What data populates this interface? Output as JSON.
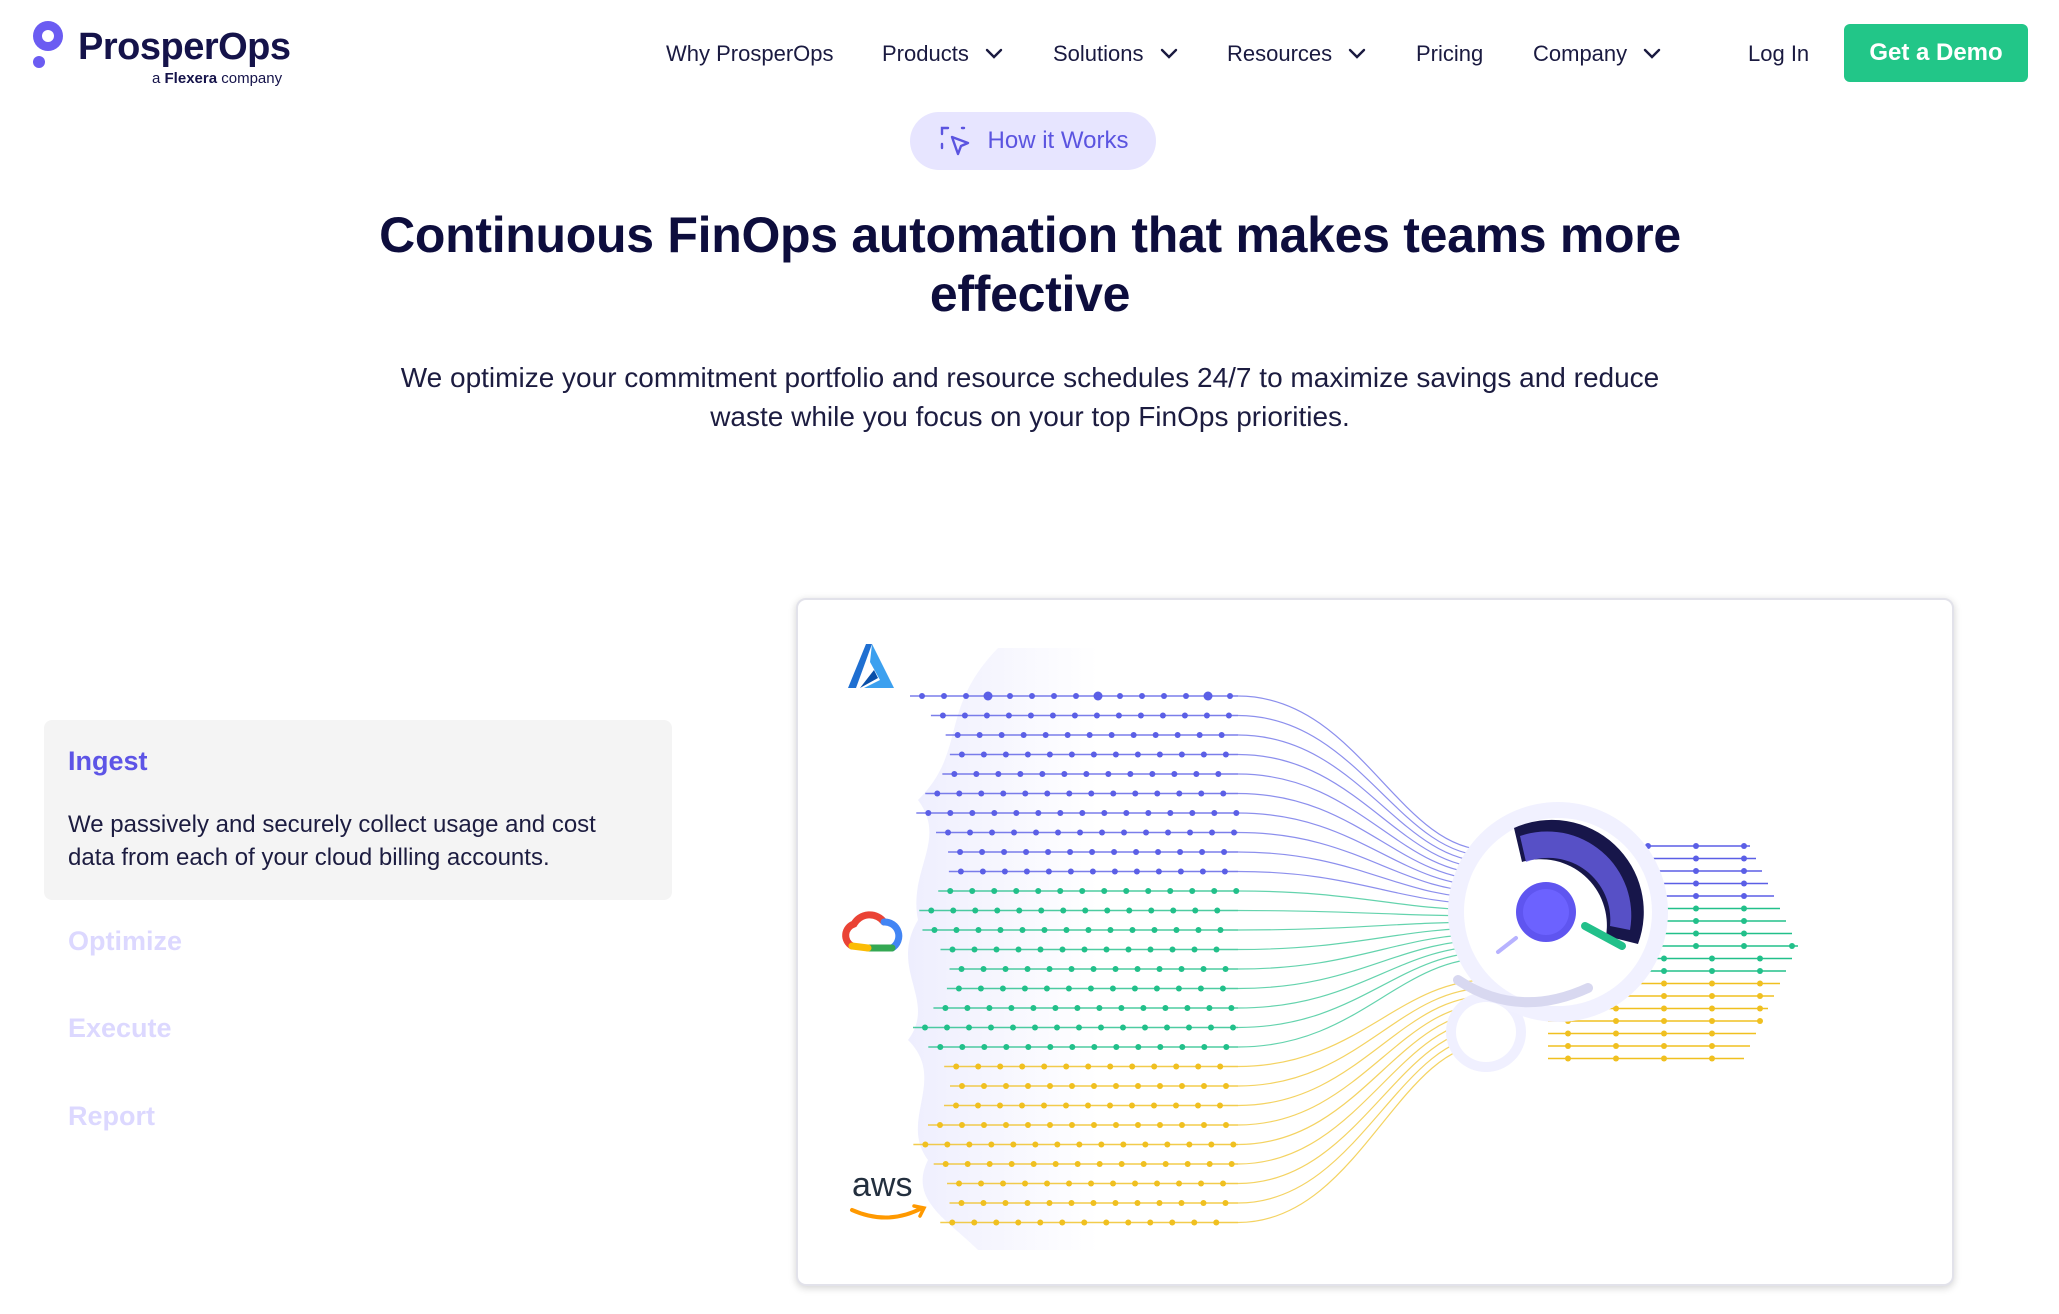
{
  "header": {
    "logo": {
      "name": "ProsperOps",
      "tagline_prefix": "a",
      "tagline_brand": "Flexera",
      "tagline_suffix": "company",
      "icon": "prosperops-logo-icon"
    },
    "nav": [
      {
        "label": "Why ProsperOps",
        "has_dropdown": false
      },
      {
        "label": "Products",
        "has_dropdown": true
      },
      {
        "label": "Solutions",
        "has_dropdown": true
      },
      {
        "label": "Resources",
        "has_dropdown": true
      },
      {
        "label": "Pricing",
        "has_dropdown": false
      },
      {
        "label": "Company",
        "has_dropdown": true
      }
    ],
    "login_label": "Log In",
    "cta_label": "Get a Demo"
  },
  "hero": {
    "pill_label": "How it Works",
    "pill_icon": "cursor-click-icon",
    "title": "Continuous FinOps automation that makes teams more effective",
    "subtitle": "We optimize your commitment portfolio and resource schedules 24/7 to maximize savings and reduce waste while you focus on your top FinOps priorities."
  },
  "steps": [
    {
      "title": "Ingest",
      "description": "We passively and securely collect usage and cost data from each of your cloud billing accounts.",
      "active": true
    },
    {
      "title": "Optimize",
      "active": false
    },
    {
      "title": "Execute",
      "active": false
    },
    {
      "title": "Report",
      "active": false
    }
  ],
  "diagram": {
    "sources": [
      {
        "icon": "azure-logo-icon",
        "color": "#5b5fe6"
      },
      {
        "icon": "google-cloud-logo-icon",
        "color": "#22c08a"
      },
      {
        "icon": "aws-logo-icon",
        "label": "aws",
        "color": "#f0c020"
      }
    ]
  },
  "colors": {
    "accent": "#5d54e6",
    "cta": "#22c688",
    "pill_bg": "#e7e5ff",
    "text": "#0d0d3d"
  }
}
